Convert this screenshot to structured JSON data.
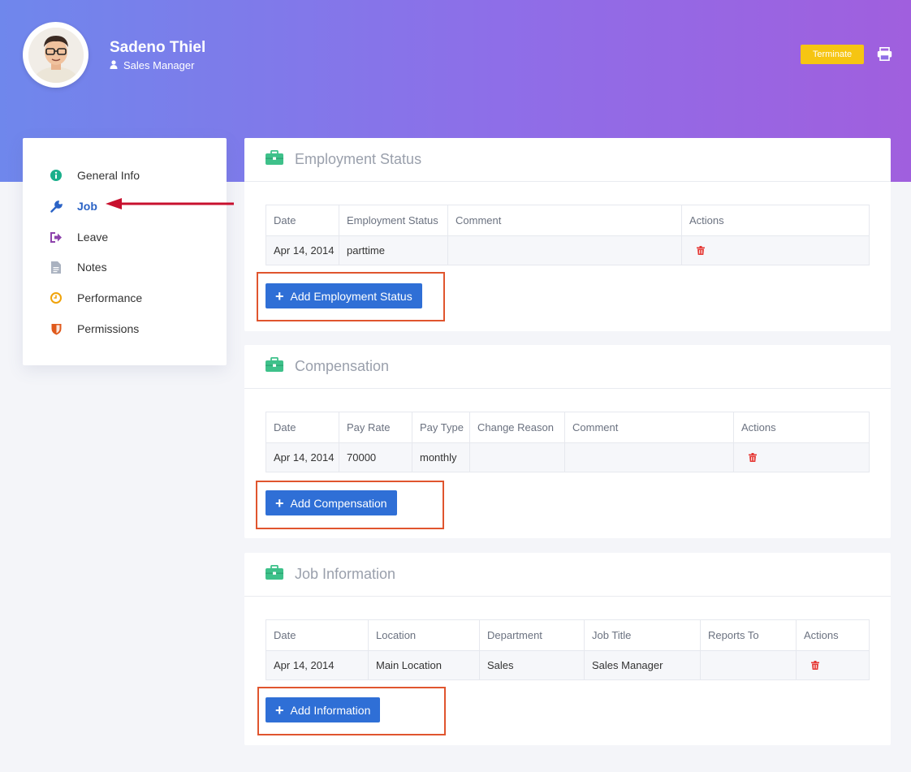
{
  "profile": {
    "name": "Sadeno Thiel",
    "role": "Sales Manager",
    "terminate_label": "Terminate"
  },
  "sidebar": {
    "items": [
      {
        "label": "General Info",
        "icon": "info-icon",
        "color": "#1aaf8b"
      },
      {
        "label": "Job",
        "icon": "wrench-icon",
        "color": "#2b63c6",
        "active": true
      },
      {
        "label": "Leave",
        "icon": "sign-out-icon",
        "color": "#8e44ad"
      },
      {
        "label": "Notes",
        "icon": "document-icon",
        "color": "#aab2c0"
      },
      {
        "label": "Performance",
        "icon": "clock-icon",
        "color": "#f0a30a"
      },
      {
        "label": "Permissions",
        "icon": "shield-icon",
        "color": "#e05a1c"
      }
    ]
  },
  "employment_status": {
    "title": "Employment Status",
    "columns": [
      "Date",
      "Employment Status",
      "Comment",
      "Actions"
    ],
    "rows": [
      [
        "Apr 14, 2014",
        "parttime",
        ""
      ]
    ],
    "add_label": "Add Employment Status"
  },
  "compensation": {
    "title": "Compensation",
    "columns": [
      "Date",
      "Pay Rate",
      "Pay Type",
      "Change Reason",
      "Comment",
      "Actions"
    ],
    "rows": [
      [
        "Apr 14, 2014",
        "70000",
        "monthly",
        "",
        ""
      ]
    ],
    "add_label": "Add Compensation"
  },
  "job_information": {
    "title": "Job Information",
    "columns": [
      "Date",
      "Location",
      "Department",
      "Job Title",
      "Reports To",
      "Actions"
    ],
    "rows": [
      [
        "Apr 14, 2014",
        "Main Location",
        "Sales",
        "Sales Manager",
        ""
      ]
    ],
    "add_label": "Add Information"
  },
  "colors": {
    "primary": "#2f6fd6",
    "terminate": "#f6c512",
    "danger": "#e53935",
    "highlight": "#e0552e",
    "briefcase": "#3ec18a"
  }
}
